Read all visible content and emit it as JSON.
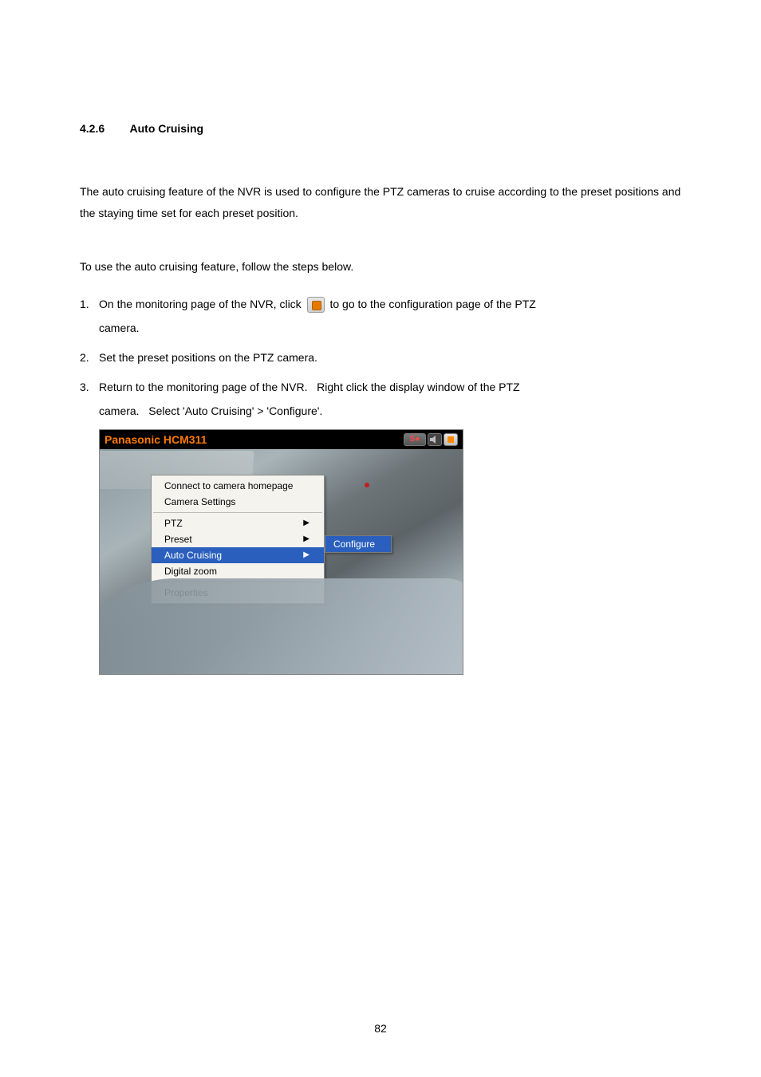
{
  "heading": {
    "number": "4.2.6",
    "title": "Auto Cruising"
  },
  "para1": "The auto cruising feature of the NVR is used to configure the PTZ cameras to cruise according to the preset positions and the staying time set for each preset position.",
  "para2": "To use the auto cruising feature, follow the steps below.",
  "steps": {
    "s1a": "On the monitoring page of the NVR, click",
    "s1b": "to go to the configuration page of the PTZ",
    "s1c": "camera.",
    "s2": "Set the preset positions on the PTZ camera.",
    "s3a": "Return to the monitoring page of the NVR.",
    "s3b": "Right click the display window of the PTZ",
    "s3c": "camera.",
    "s3d": "Select 'Auto Cruising' > 'Configure'."
  },
  "numbers": {
    "n1": "1.",
    "n2": "2.",
    "n3": "3."
  },
  "figure": {
    "title": "Panasonic HCM311",
    "btn_rec": "S●",
    "contextMenu": {
      "connect": "Connect to camera homepage",
      "settings": "Camera Settings",
      "ptz": "PTZ",
      "preset": "Preset",
      "autoCruising": "Auto Cruising",
      "digitalZoom": "Digital zoom",
      "properties": "Properties"
    },
    "submenu": {
      "configure": "Configure"
    }
  },
  "pageNumber": "82"
}
